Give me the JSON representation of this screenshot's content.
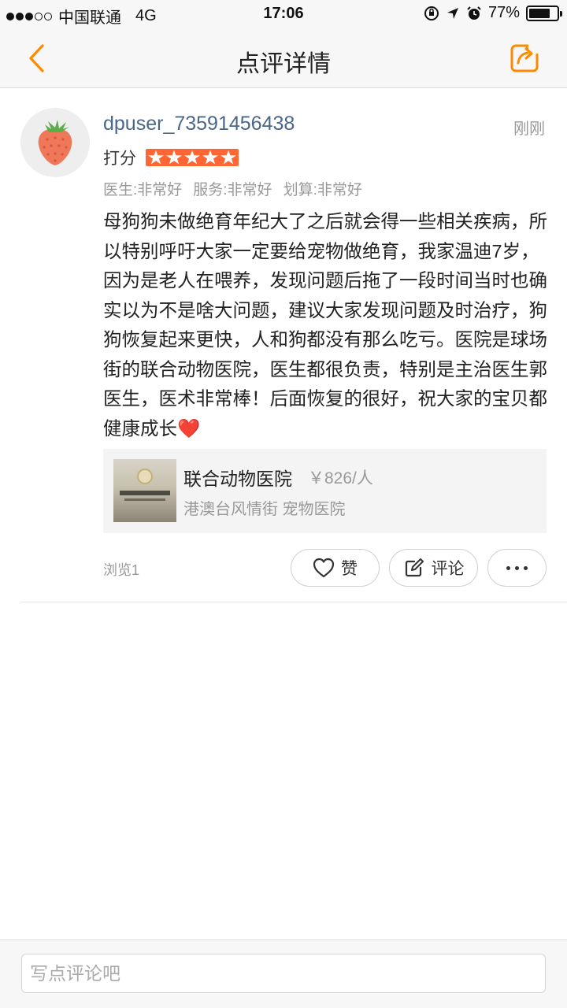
{
  "status_bar": {
    "carrier": "中国联通",
    "network": "4G",
    "time": "17:06",
    "battery": "77%",
    "battery_level": 0.77
  },
  "nav": {
    "title": "点评详情",
    "back_icon": "chevron-left-icon",
    "share_icon": "share-icon",
    "accent_color": "#ff8a00"
  },
  "review": {
    "username": "dpuser_73591456438",
    "time": "刚刚",
    "rating_label": "打分",
    "stars": 5,
    "star_color": "#ff6633",
    "sub_scores": [
      "医生:非常好",
      "服务:非常好",
      "划算:非常好"
    ],
    "text": "母狗狗未做绝育年纪大了之后就会得一些相关疾病，所以特别呼吁大家一定要给宠物做绝育，我家温迪7岁，因为是老人在喂养，发现问题后拖了一段时间当时也确实以为不是啥大问题，建议大家发现问题及时治疗，狗狗恢复起来更快，人和狗都没有那么吃亏。医院是球场街的联合动物医院，医生都很负责，特别是主治医生郭医生，医术非常棒！后面恢复的很好，祝大家的宝贝都健康成长",
    "heart_emoji": "❤️"
  },
  "shop": {
    "name": "联合动物医院",
    "price": "￥826/人",
    "meta": "港澳台风情街 宠物医院"
  },
  "footer": {
    "views": "浏览1",
    "like_label": "赞",
    "comment_label": "评论"
  },
  "bottom_bar": {
    "placeholder": "写点评论吧"
  }
}
